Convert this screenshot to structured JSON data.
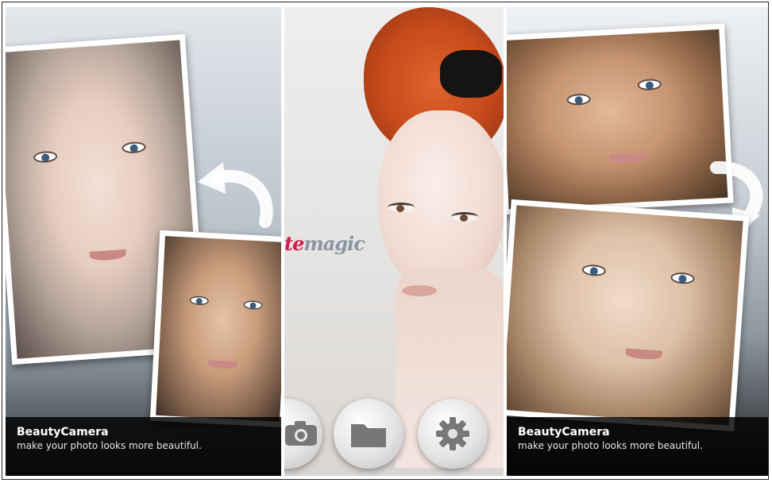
{
  "left_panel": {
    "caption_title": "BeautyCamera",
    "caption_subtitle": "make your photo looks more beautiful."
  },
  "middle_panel": {
    "logo_part1": "te",
    "logo_part2": "magic",
    "buttons": [
      {
        "icon": "camera-icon"
      },
      {
        "icon": "folder-icon"
      },
      {
        "icon": "gear-icon"
      }
    ]
  },
  "right_panel": {
    "caption_title": "BeautyCamera",
    "caption_subtitle": "make your photo looks more beautiful."
  },
  "colors": {
    "logo_red": "#d11d49",
    "logo_gray": "#8a95a3",
    "caption_bg": "#000000"
  }
}
